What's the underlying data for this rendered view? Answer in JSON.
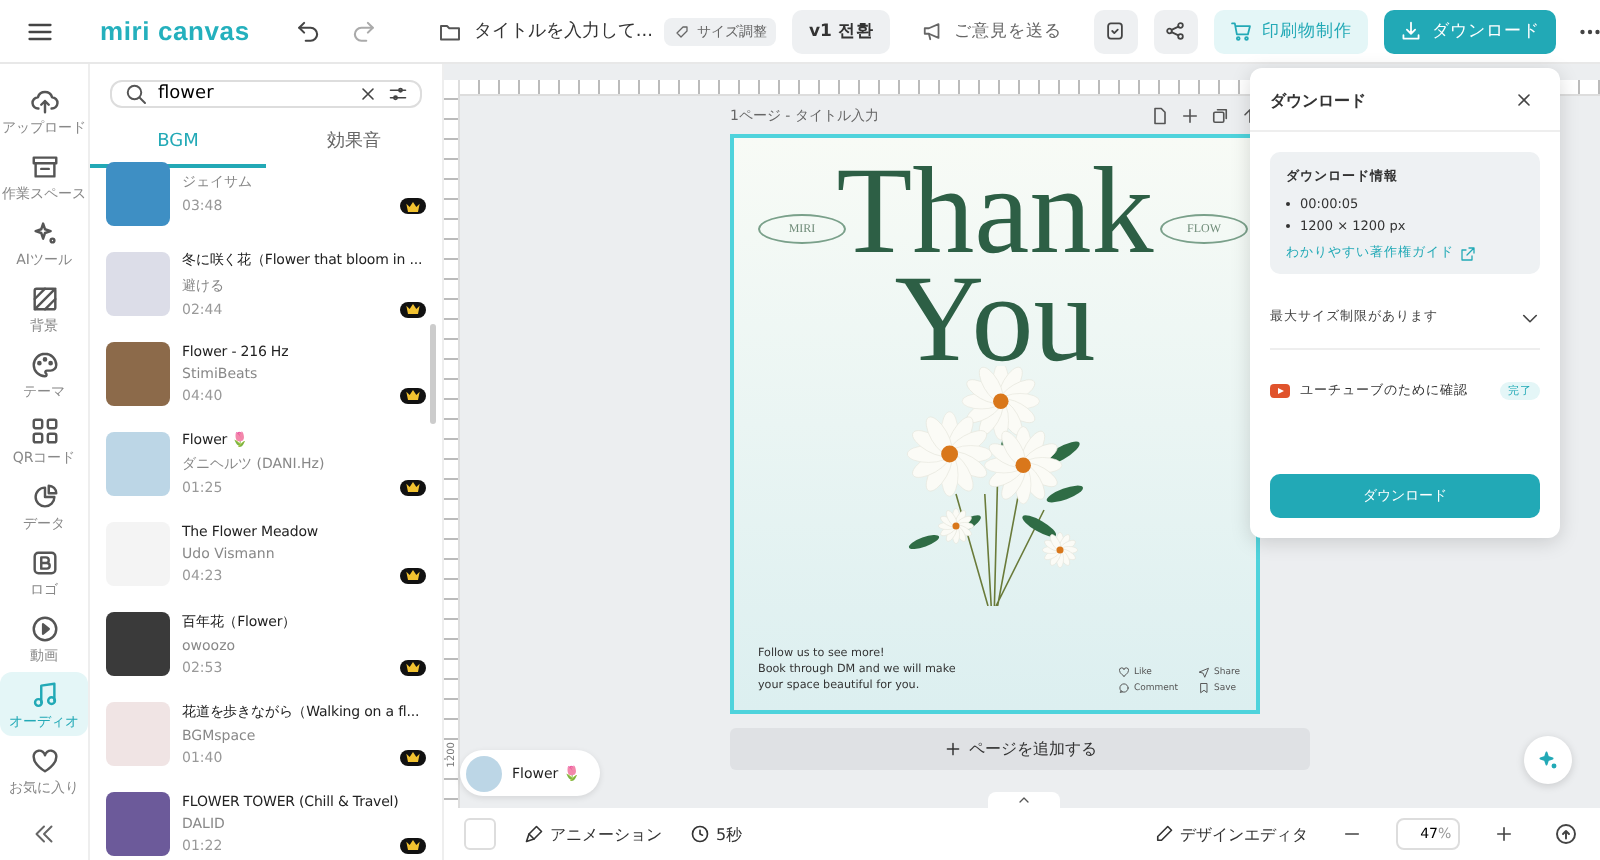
{
  "topbar": {
    "logo": "miri canvas",
    "title": "タイトルを入力して...",
    "resize": "サイズ調整",
    "version": "v1 전환",
    "feedback": "ご意見を送る",
    "print": "印刷物制作",
    "download": "ダウンロード"
  },
  "sidebar": {
    "items": [
      {
        "label": "アップロード",
        "selected": false
      },
      {
        "label": "作業スペース",
        "selected": false
      },
      {
        "label": "AIツール",
        "selected": false
      },
      {
        "label": "背景",
        "selected": false
      },
      {
        "label": "テーマ",
        "selected": false
      },
      {
        "label": "QRコード",
        "selected": false
      },
      {
        "label": "データ",
        "selected": false
      },
      {
        "label": "ロゴ",
        "selected": false
      },
      {
        "label": "動画",
        "selected": false
      },
      {
        "label": "オーディオ",
        "selected": true
      },
      {
        "label": "お気に入り",
        "selected": false
      }
    ]
  },
  "panel": {
    "search": {
      "value": "flower"
    },
    "tabs": [
      {
        "label": "BGM",
        "selected": true
      },
      {
        "label": "効果音",
        "selected": false
      }
    ],
    "tracks": [
      {
        "artist": "ジェイサム",
        "duration": "03:48",
        "premium": true
      },
      {
        "title": "冬に咲く花（Flower that bloom in ...",
        "artist": "避ける",
        "duration": "02:44",
        "premium": true
      },
      {
        "title": "Flower - 216 Hz",
        "artist": "StimiBeats",
        "duration": "04:40",
        "premium": true
      },
      {
        "title": "Flower 🌷",
        "artist": "ダニヘルツ (DANI.Hz)",
        "duration": "01:25",
        "premium": true
      },
      {
        "title": "The Flower Meadow",
        "artist": "Udo Vismann",
        "duration": "04:23",
        "premium": true
      },
      {
        "title": "百年花（Flower）",
        "artist": "owoozo",
        "duration": "02:53",
        "premium": true
      },
      {
        "title": "花道を歩きながら（Walking on a fl...",
        "artist": "BGMspace",
        "duration": "01:40",
        "premium": true
      },
      {
        "title": "FLOWER TOWER (Chill & Travel)",
        "artist": "DALID",
        "duration": "01:22",
        "premium": true
      }
    ]
  },
  "canvas": {
    "ruler_mark": "1200",
    "page_label": "1ページ - タイトル入力",
    "design": {
      "pill_left": "MIRI",
      "pill_right": "FLOW",
      "headline": [
        "Thank",
        "You"
      ],
      "footer_text": [
        "Follow us to see more!",
        "Book through DM and we will make",
        "your space beautiful for you."
      ],
      "actions": [
        "Like",
        "Share",
        "Comment",
        "Save"
      ]
    },
    "add_page": "ページを追加する"
  },
  "download_panel": {
    "title": "ダウンロード",
    "info_title": "ダウンロード情報",
    "info_items": [
      "00:00:05",
      "1200 × 1200 px"
    ],
    "guide_link": "わかりやすい著作権ガイド",
    "size_limit": {
      "label": "最大サイズ制限があります",
      "expanded": false
    },
    "youtube_check": {
      "label": "ユーチューブのために確認",
      "status": "完了"
    },
    "button": "ダウンロード"
  },
  "now_playing": {
    "title": "Flower 🌷"
  },
  "bottom_bar": {
    "animation": "アニメーション",
    "duration": "5秒",
    "design_editor": "デザインエディタ",
    "zoom": "47",
    "zoom_unit": "%"
  }
}
